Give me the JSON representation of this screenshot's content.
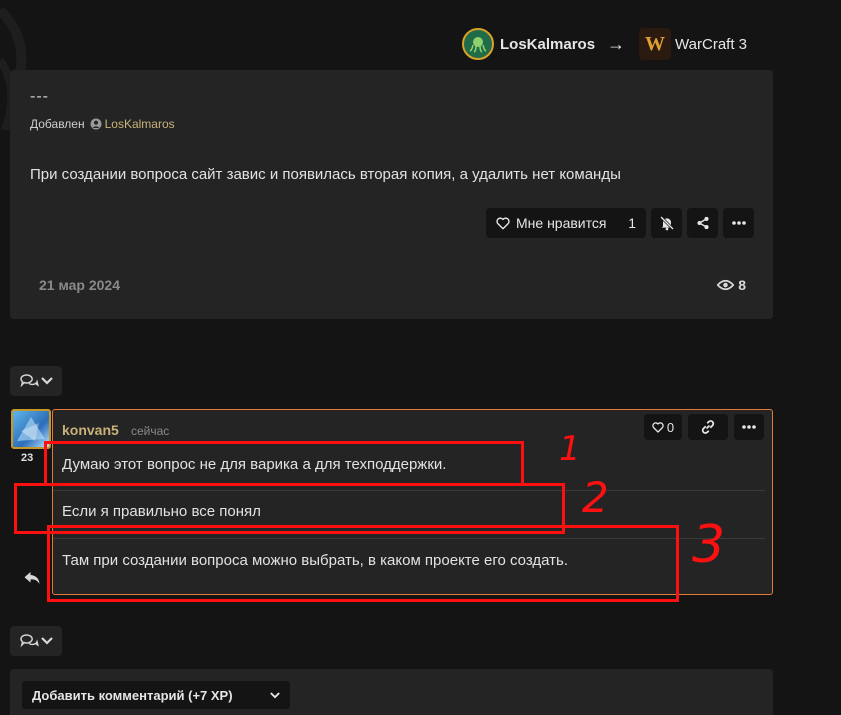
{
  "breadcrumb": {
    "user": "LosKalmaros",
    "arrow": "→",
    "game": "WarCraft 3",
    "game_icon_letter": "W"
  },
  "post": {
    "dashes": "---",
    "added_label": "Добавлен",
    "added_user": "LosKalmaros",
    "body": "При создании вопроса сайт завис и появилась вторая копия, а удалить нет команды",
    "like_label": "Мне нравится",
    "like_count": "1",
    "date": "21 мар 2024",
    "views": "8"
  },
  "comment": {
    "level": "23",
    "author": "konvan5",
    "time": "сейчас",
    "like_count": "0",
    "lines": [
      "Думаю этот вопрос не для варика а для техподдержки.",
      "Если я правильно все понял",
      "Там при создании вопроса можно выбрать, в каком проекте его создать."
    ]
  },
  "annotations": [
    "1",
    "2",
    "3"
  ],
  "add_comment": {
    "label": "Добавить комментарий (+7 XP)"
  },
  "colors": {
    "background": "#141414",
    "card": "#242424",
    "accent_orange": "#e07a3a",
    "username_gold": "#c9b27a",
    "annotation_red": "#ff1010"
  }
}
